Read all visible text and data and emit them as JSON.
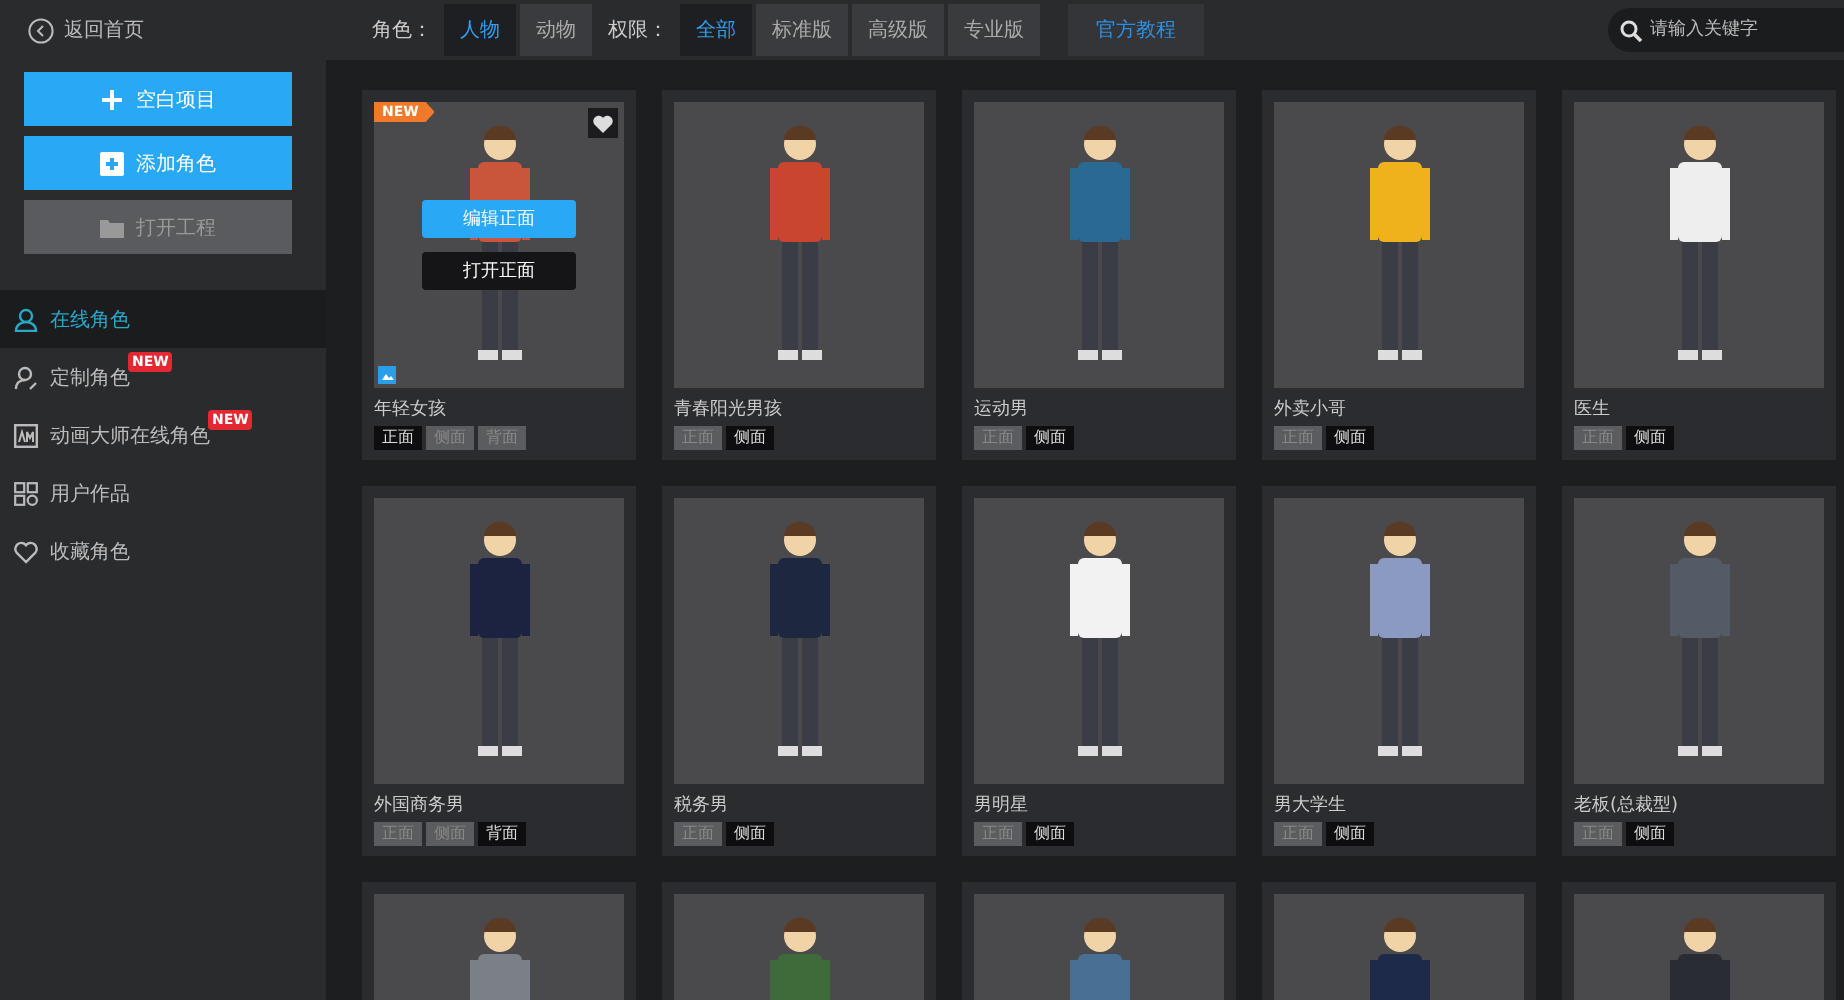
{
  "topbar": {
    "back": "返回首页",
    "filters": [
      {
        "label": "角色：",
        "options": [
          {
            "label": "人物",
            "selected": true
          },
          {
            "label": "动物",
            "selected": false
          }
        ]
      },
      {
        "label": "权限：",
        "options": [
          {
            "label": "全部",
            "selected": true
          },
          {
            "label": "标准版",
            "selected": false
          },
          {
            "label": "高级版",
            "selected": false
          },
          {
            "label": "专业版",
            "selected": false
          }
        ]
      }
    ],
    "tutorial": "官方教程",
    "search": {
      "placeholder": "请输入关键字"
    }
  },
  "sidebar": {
    "actions": [
      {
        "label": "空白项目",
        "disabled": false
      },
      {
        "label": "添加角色",
        "disabled": false
      },
      {
        "label": "打开工程",
        "disabled": true
      }
    ],
    "items": [
      {
        "label": "在线角色",
        "selected": true
      },
      {
        "label": "定制角色",
        "selected": false,
        "badge": "NEW"
      },
      {
        "label": "动画大师在线角色",
        "selected": false,
        "badge": "NEW"
      },
      {
        "label": "用户作品",
        "selected": false
      },
      {
        "label": "收藏角色",
        "selected": false
      }
    ]
  },
  "cards": [
    {
      "name": "年轻女孩",
      "color": "#c9553a",
      "new_badge": "NEW",
      "hovered": true,
      "edit_button": "编辑正面",
      "open_button": "打开正面",
      "tags": [
        {
          "label": "正面",
          "selected": true
        },
        {
          "label": "侧面",
          "selected": false
        },
        {
          "label": "背面",
          "selected": false
        }
      ]
    },
    {
      "name": "青春阳光男孩",
      "color": "#c9452f",
      "tags": [
        {
          "label": "正面",
          "selected": false
        },
        {
          "label": "侧面",
          "selected": true
        }
      ]
    },
    {
      "name": "运动男",
      "color": "#2a6a92",
      "tags": [
        {
          "label": "正面",
          "selected": false
        },
        {
          "label": "侧面",
          "selected": true
        }
      ]
    },
    {
      "name": "外卖小哥",
      "color": "#f0b21a",
      "tags": [
        {
          "label": "正面",
          "selected": false
        },
        {
          "label": "侧面",
          "selected": true
        }
      ]
    },
    {
      "name": "医生",
      "color": "#eeeeee",
      "tags": [
        {
          "label": "正面",
          "selected": false
        },
        {
          "label": "侧面",
          "selected": true
        }
      ]
    },
    {
      "name": "外国商务男",
      "color": "#1c2340",
      "tags": [
        {
          "label": "正面",
          "selected": false
        },
        {
          "label": "侧面",
          "selected": false
        },
        {
          "label": "背面",
          "selected": true
        }
      ]
    },
    {
      "name": "税务男",
      "color": "#1d2740",
      "tags": [
        {
          "label": "正面",
          "selected": false
        },
        {
          "label": "侧面",
          "selected": true
        }
      ]
    },
    {
      "name": "男明星",
      "color": "#f2f2f2",
      "tags": [
        {
          "label": "正面",
          "selected": false
        },
        {
          "label": "侧面",
          "selected": true
        }
      ]
    },
    {
      "name": "男大学生",
      "color": "#8a9ac0",
      "tags": [
        {
          "label": "正面",
          "selected": false
        },
        {
          "label": "侧面",
          "selected": true
        }
      ]
    },
    {
      "name": "老板(总裁型)",
      "color": "#555b66",
      "tags": [
        {
          "label": "正面",
          "selected": false
        },
        {
          "label": "侧面",
          "selected": true
        }
      ]
    },
    {
      "color": "#7a7f88"
    },
    {
      "color": "#3f6a3a"
    },
    {
      "color": "#4a6f94"
    },
    {
      "color": "#1e2a4a"
    },
    {
      "color": "#2a2c33"
    }
  ]
}
